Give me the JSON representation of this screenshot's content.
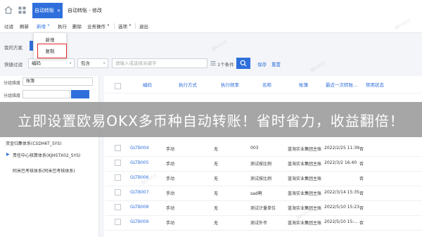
{
  "tabs": {
    "active_label": "自动转账",
    "close_glyph": "✕",
    "second_label": "自动转账 - 修改"
  },
  "toolbar": {
    "items": [
      "过滤",
      "刷新",
      "新增",
      "执行",
      "删除",
      "业务操作",
      "选项",
      "退出"
    ],
    "arrow": "∨"
  },
  "dropdown": {
    "items": [
      "新增",
      "复制"
    ]
  },
  "scheme": {
    "label": "我的方案"
  },
  "filter": {
    "label": "快捷过滤",
    "field_value": "编码",
    "operator_value": "包含",
    "search_placeholder": "请输入或选择关键字",
    "condition_count": "1个条件",
    "save_label": "保存",
    "reset_label": "重置"
  },
  "left_panel": {
    "dim_label": "分组维度",
    "dim_value": "账簿",
    "dim_label_2": "分组维度",
    "tree": [
      "资金归集体系(CSDH6T_SYS)",
      "责任中心核算体系(KJHSTX02_SYS)",
      "阿米巴考核体系(阿米巴考核体系)"
    ]
  },
  "table": {
    "columns": [
      "编码",
      "执行方式",
      "执行频率",
      "名称",
      "账簿",
      "最近一次转账...",
      "禁用状态"
    ],
    "rows": [
      {
        "code": "GLTB004",
        "mode": "手动",
        "freq": "无",
        "name": "003",
        "book": "蓝海实业集团主账",
        "last": "2022/2/25 11:39",
        "disabled": "否"
      },
      {
        "code": "GLTB005",
        "mode": "手动",
        "freq": "无",
        "name": "测试按比例",
        "book": "蓝海实业集团主账",
        "last": "2022/3/2 16:40",
        "disabled": "否"
      },
      {
        "code": "GLTB006",
        "mode": "手动",
        "freq": "无",
        "name": "测试按比例",
        "book": "蓝海实业集团主账",
        "last": "",
        "disabled": "否"
      },
      {
        "code": "GLTB007",
        "mode": "手动",
        "freq": "无",
        "name": "sad啊",
        "book": "蓝海实业集团主账",
        "last": "2022/3/14 15:35",
        "disabled": "否"
      },
      {
        "code": "GLTB008",
        "mode": "手动",
        "freq": "无",
        "name": "测试计量单位",
        "book": "蓝海实业集团主账",
        "last": "2022/5/10 15:23",
        "disabled": "否"
      },
      {
        "code": "GLTB009",
        "mode": "手动",
        "freq": "无",
        "name": "测试外币",
        "book": "蓝海实业集团主账",
        "last": "2022/5/10 15:...",
        "disabled": "否"
      }
    ]
  },
  "banner": {
    "text": "立即设置欧易OKX多币种自动转账！省时省力，收益翻倍！"
  },
  "watermark": "圆叶时代",
  "colors": {
    "accent": "#2f6fdc",
    "highlight": "#e0262a",
    "banner": "#969696"
  }
}
